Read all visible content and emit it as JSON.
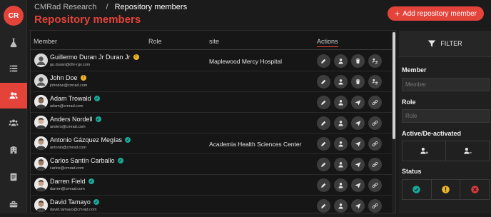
{
  "app": {
    "logo_initials": "CR"
  },
  "header": {
    "breadcrumb_root": "CMRad Research",
    "breadcrumb_sep": "/",
    "breadcrumb_current": "Repository members",
    "title": "Repository members",
    "add_button_label": "Add repository member"
  },
  "sidebar": {
    "items": [
      {
        "icon": "flask-icon",
        "active": false
      },
      {
        "icon": "list-icon",
        "active": false
      },
      {
        "icon": "users-icon",
        "active": true
      },
      {
        "icon": "group-icon",
        "active": false
      },
      {
        "icon": "building-icon",
        "active": false
      },
      {
        "icon": "document-icon",
        "active": false
      },
      {
        "icon": "toolbox-icon",
        "active": false
      }
    ]
  },
  "table": {
    "columns": [
      "Member",
      "Role",
      "site",
      "Actions"
    ],
    "rows": [
      {
        "name": "Guillermo Duran Jr Duran Jr",
        "email": "gu.duran@dhr-rgv.com",
        "site": "Maplewood Mercy Hospital",
        "status": "warning",
        "actions": [
          "edit",
          "person",
          "delete",
          "reassign"
        ]
      },
      {
        "name": "John Doe",
        "email": "johndoe@cmrad.com",
        "site": "",
        "status": "warning",
        "actions": [
          "edit",
          "person",
          "delete",
          "reassign"
        ]
      },
      {
        "name": "Adam Trowald",
        "email": "adam@cmrad.com",
        "site": "",
        "status": "verified",
        "actions": [
          "edit",
          "person",
          "send",
          "link"
        ]
      },
      {
        "name": "Anders Nordell",
        "email": "anders@cmrad.com",
        "site": "",
        "status": "verified",
        "actions": [
          "edit",
          "person",
          "send",
          "link"
        ]
      },
      {
        "name": "Antonio Gázquez Megías",
        "email": "antonio@cmrad.com",
        "site": "Academia Health Sciences Center",
        "status": "verified",
        "actions": [
          "edit",
          "person",
          "send",
          "link"
        ]
      },
      {
        "name": "Carlos Santín Carballo",
        "email": "carlos@cmrad.com",
        "site": "",
        "status": "verified",
        "actions": [
          "edit",
          "person",
          "send",
          "link"
        ]
      },
      {
        "name": "Darren Field",
        "email": "darren@cmrad.com",
        "site": "",
        "status": "verified",
        "actions": [
          "edit",
          "person",
          "send",
          "link"
        ]
      },
      {
        "name": "David Tamayo",
        "email": "david.tamayo@cmrad.com",
        "site": "",
        "status": "verified",
        "actions": [
          "edit",
          "person",
          "send",
          "link"
        ]
      }
    ]
  },
  "filter": {
    "header_label": "FILTER",
    "member_label": "Member",
    "member_placeholder": "Member",
    "role_label": "Role",
    "role_placeholder": "Role",
    "active_label": "Active/De-activated",
    "status_label": "Status"
  },
  "colors": {
    "accent": "#e4433a",
    "verified": "#19a999",
    "warning": "#f0b429"
  }
}
